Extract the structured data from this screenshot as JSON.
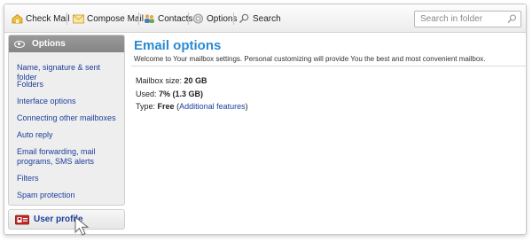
{
  "toolbar": {
    "check_mail": "Check Mail",
    "compose_mail": "Compose Mail",
    "contacts": "Contacts",
    "options": "Options",
    "search": "Search",
    "search_placeholder": "Search in folder"
  },
  "sidebar": {
    "header": "Options",
    "items": [
      {
        "label": "Name, signature & sent folder"
      },
      {
        "label": "Folders"
      },
      {
        "label": "Interface options"
      },
      {
        "label": "Connecting other mailboxes"
      },
      {
        "label": "Auto reply"
      },
      {
        "label": "Email forwarding, mail programs, SMS alerts"
      },
      {
        "label": "Filters"
      },
      {
        "label": "Spam protection"
      }
    ],
    "profile_label": "User profile"
  },
  "main": {
    "title": "Email options",
    "subtitle": "Welcome to Your mailbox settings. Personal customizing will provide You the best and most convenient mailbox.",
    "mailbox_size_label": "Mailbox size:",
    "mailbox_size_value": "20 GB",
    "used_label": "Used:",
    "used_value": "7% (1.3 GB)",
    "type_label": "Type:",
    "type_value": "Free",
    "type_link_open": "(",
    "type_link": "Additional features",
    "type_link_close": ")"
  },
  "colors": {
    "accent": "#2a8ad2",
    "link": "#1c3e9c",
    "sidebar_header": "#8e8e8e"
  }
}
